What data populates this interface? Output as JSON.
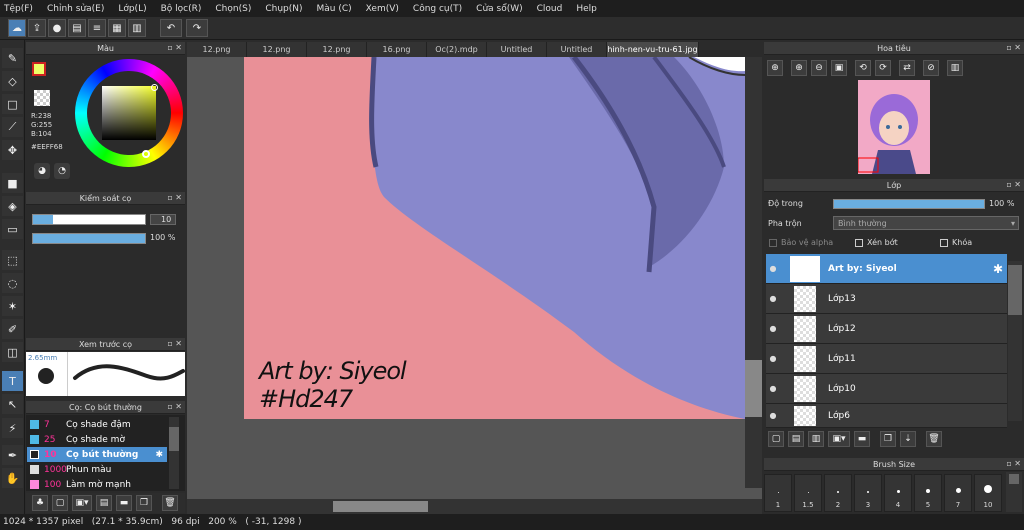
{
  "menu": [
    "Tệp(F)",
    "Chỉnh sửa(E)",
    "Lớp(L)",
    "Bộ lọc(R)",
    "Chọn(S)",
    "Chụp(N)",
    "Màu (C)",
    "Xem(V)",
    "Công cụ(T)",
    "Cửa sổ(W)",
    "Cloud",
    "Help"
  ],
  "color_panel": {
    "title": "Màu",
    "r": "R:238",
    "g": "G:255",
    "b": "B:104",
    "hex": "#EEFF68"
  },
  "brush_control": {
    "title": "Kiểm soát cọ",
    "size": "10",
    "opacity": "100 %"
  },
  "brush_preview": {
    "title": "Xem trước cọ",
    "size": "2.65mm"
  },
  "brush_list": {
    "title": "Cọ: Cọ bút thường",
    "items": [
      {
        "size": "7",
        "name": "Cọ shade đậm",
        "color": "#4fb9e6"
      },
      {
        "size": "25",
        "name": "Cọ shade mờ",
        "color": "#4fb9e6"
      },
      {
        "size": "10",
        "name": "Cọ bút thường",
        "color": "#222222"
      },
      {
        "size": "1000",
        "name": "Phun màu",
        "color": "#dddddd"
      },
      {
        "size": "100",
        "name": "Làm mờ mạnh",
        "color": "#ff88dd"
      }
    ]
  },
  "tabs": [
    "12.png",
    "12.png",
    "12.png",
    "16.png",
    "Oc(2).mdp",
    "Untitled",
    "Untitled",
    "hinh-nen-vu-tru-61.jpg"
  ],
  "canvas": {
    "line1": "Art by: Siyeol",
    "line2": "#Hd247"
  },
  "navigator": {
    "title": "Hoa tiêu"
  },
  "layer_panel": {
    "title": "Lớp",
    "opacity_label": "Độ trong",
    "opacity_value": "100 %",
    "blend_label": "Pha trộn",
    "blend_value": "Bình thường",
    "protect_alpha": "Bảo vệ alpha",
    "clip": "Xén bớt",
    "lock": "Khóa",
    "layers": [
      "Art by: Siyeol",
      "Lớp13",
      "Lớp12",
      "Lớp11",
      "Lớp10",
      "Lớp6"
    ]
  },
  "brush_size": {
    "title": "Brush Size",
    "sizes": [
      "1",
      "1.5",
      "2",
      "3",
      "4",
      "5",
      "7",
      "10"
    ]
  },
  "status": {
    "text": "1024 * 1357 pixel   (27.1 * 35.9cm)   96 dpi   200 %   ( -31, 1298 )"
  }
}
